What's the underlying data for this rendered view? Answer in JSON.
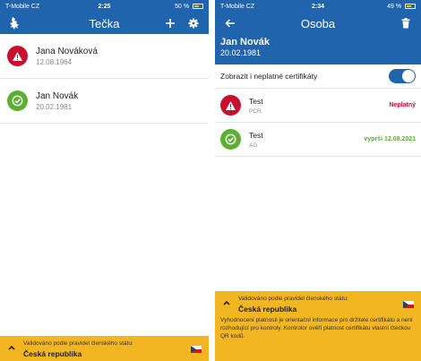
{
  "left": {
    "status_bar": {
      "carrier": "T-Mobile CZ",
      "time": "2:25",
      "battery": "50 %"
    },
    "header": {
      "title": "Tečka",
      "icons": [
        "lion-logo-icon",
        "add-icon",
        "settings-icon"
      ]
    },
    "people": [
      {
        "name": "Jana Nováková",
        "date": "12.08.1964",
        "status": "invalid"
      },
      {
        "name": "Jan Novák",
        "date": "20.02.1981",
        "status": "valid"
      }
    ],
    "banner": {
      "validated_text": "Validováno podle pravidel členského státu:",
      "country": "Česká republika"
    }
  },
  "right": {
    "status_bar": {
      "carrier": "T-Mobile CZ",
      "time": "2:34",
      "battery": "49 %"
    },
    "header": {
      "title": "Osoba",
      "icons": [
        "back-arrow-icon",
        "trash-icon"
      ]
    },
    "person": {
      "name": "Jan Novák",
      "date": "20.02.1981"
    },
    "toggle": {
      "label": "Zobrazit i neplatné certifikáty",
      "on": true
    },
    "certificates": [
      {
        "name": "Test",
        "type": "PCR",
        "status_text": "Neplatný",
        "status": "invalid"
      },
      {
        "name": "Test",
        "type": "AG",
        "status_text": "vyprší 12.08.2021",
        "status": "valid"
      }
    ],
    "banner": {
      "validated_text": "Validováno podle pravidel členského státu:",
      "country": "Česká republika",
      "info": "Vyhodnocení platnosti je orientační informace pro držitele certifikátu a není rozhodující pro kontroly. Kontrolor ověří platnost certifikátu vlastní čtečkou QR kódů."
    }
  },
  "colors": {
    "primary": "#1f64ad",
    "invalid": "#c8102e",
    "valid": "#5bb033",
    "banner": "#f2b622"
  }
}
